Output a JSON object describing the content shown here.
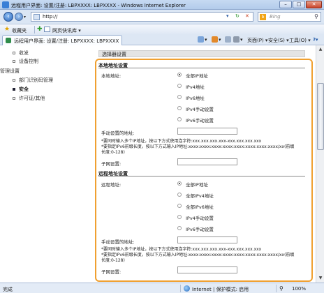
{
  "window": {
    "title": "远程用户界面: 设置/注册: LBPXXXX: LBPXXXX - Windows Internet Explorer",
    "minimize": "–",
    "maximize": "□",
    "close": "✕"
  },
  "address": {
    "url": "http://",
    "search_placeholder": "Bing"
  },
  "favorites": {
    "label": "收藏夹",
    "gallery": "网页快讯库 ▾"
  },
  "tab": {
    "label": "远程用户界面: 设置/注册: LBPXXXX: LBPXXXX"
  },
  "commands": {
    "page": "页面(P) ▾",
    "safety": "安全(S) ▾",
    "tools": "工具(O) ▾",
    "help": "?▾"
  },
  "sidebar": {
    "items": [
      {
        "label": "收发"
      },
      {
        "label": "设备控制"
      },
      {
        "label": "管理设置"
      },
      {
        "label": "部门识别码管理"
      },
      {
        "label": "安全"
      },
      {
        "label": "许可证/其他"
      }
    ]
  },
  "main": {
    "heading": "选择器设置",
    "local": {
      "title": "本地地址设置",
      "field_label": "本地地址:",
      "options": [
        "全部IP地址",
        "IPv4地址",
        "IPv6地址",
        "IPv4手动设置",
        "IPv6手动设置"
      ],
      "manual_label": "手动设置的地址:",
      "note1": "*要同时输入多个IP地址，按以下方式使用连字符:xxx.xxx.xxx.xxx-xxx.xxx.xxx.xxx",
      "note2": "*要指定IPv6前缀长度，按以下方式输入IP地址:xxxx:xxxx:xxxx:xxxx:xxxx:xxxx:xxxx:xxxx/xx(前缀",
      "note3": "长度:0-128)",
      "subnet_label": "子网设置:"
    },
    "remote": {
      "title": "远程地址设置",
      "field_label": "远程地址:",
      "options": [
        "全部IP地址",
        "全部IPv4地址",
        "全部IPv6地址",
        "IPv4手动设置",
        "IPv6手动设置"
      ],
      "manual_label": "手动设置的地址:",
      "note1": "*要同时输入多个IP地址，按以下方式使用连字符:xxx.xxx.xxx.xxx-xxx.xxx.xxx.xxx",
      "note2": "*要指定IPv6前缀长度，按以下方式输入IP地址:xxxx:xxxx:xxxx:xxxx:xxxx:xxxx:xxxx:xxxx/xx(前缀",
      "note3": "长度:0-128)",
      "subnet_label": "子网设置:"
    }
  },
  "status": {
    "text": "完成",
    "zone": "Internet | 保护模式: 启用",
    "zoom": "100%"
  },
  "colors": {
    "highlight": "#f0a030"
  }
}
